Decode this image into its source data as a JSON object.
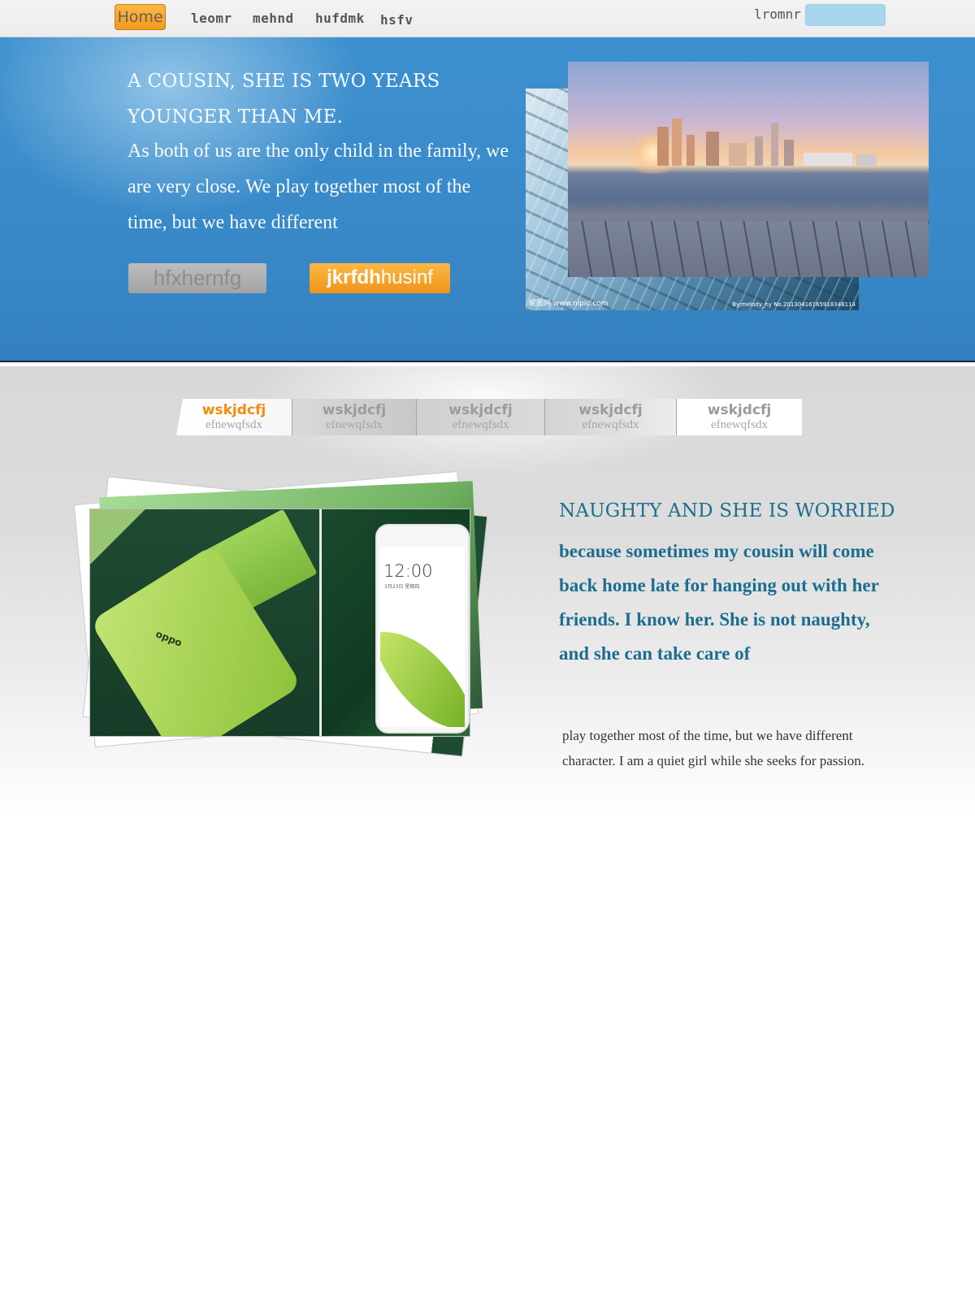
{
  "nav": {
    "home": "Home",
    "links": [
      "leomr",
      "mehnd",
      "hufdmk",
      "hsfv"
    ],
    "right_label": "lromnr"
  },
  "hero": {
    "heading_line1": "A COUSIN, SHE IS TWO YEARS",
    "heading_line2": "YOUNGER THAN ME.",
    "body": "As both of us are the only child in the family, we are very close. We play together most of the time, but we have different",
    "button_gray": "hfxhernfg",
    "button_orange_bold": "jkrfdh",
    "button_orange_rest": "husinf",
    "image_back_caption_left": "昵图网 www.nipic.com",
    "image_back_caption_right": "By:melody_hy No.20130416165918348114"
  },
  "tabs": [
    {
      "title": "wskjdcfj",
      "subtitle": "efnewqfsdx",
      "active": true
    },
    {
      "title": "wskjdcfj",
      "subtitle": "efnewqfsdx",
      "active": false
    },
    {
      "title": "wskjdcfj",
      "subtitle": "efnewqfsdx",
      "active": false
    },
    {
      "title": "wskjdcfj",
      "subtitle": "efnewqfsdx",
      "active": false
    },
    {
      "title": "wskjdcfj",
      "subtitle": "efnewqfsdx",
      "active": false
    }
  ],
  "product": {
    "clock": "12:00",
    "date": "3月23日 星期四",
    "brand": "oppo"
  },
  "feature": {
    "heading": "NAUGHTY AND SHE IS WORRIED",
    "body": "because sometimes my cousin will come back home late for hanging out with her  friends. I know her. She is not naughty, and she can take care of",
    "small": "play together most of the time, but we have different character. I am a quiet girl while she seeks for passion."
  },
  "colors": {
    "accent_orange": "#f29a1c",
    "hero_blue": "#3989c8",
    "feature_teal": "#1b6e8f"
  }
}
